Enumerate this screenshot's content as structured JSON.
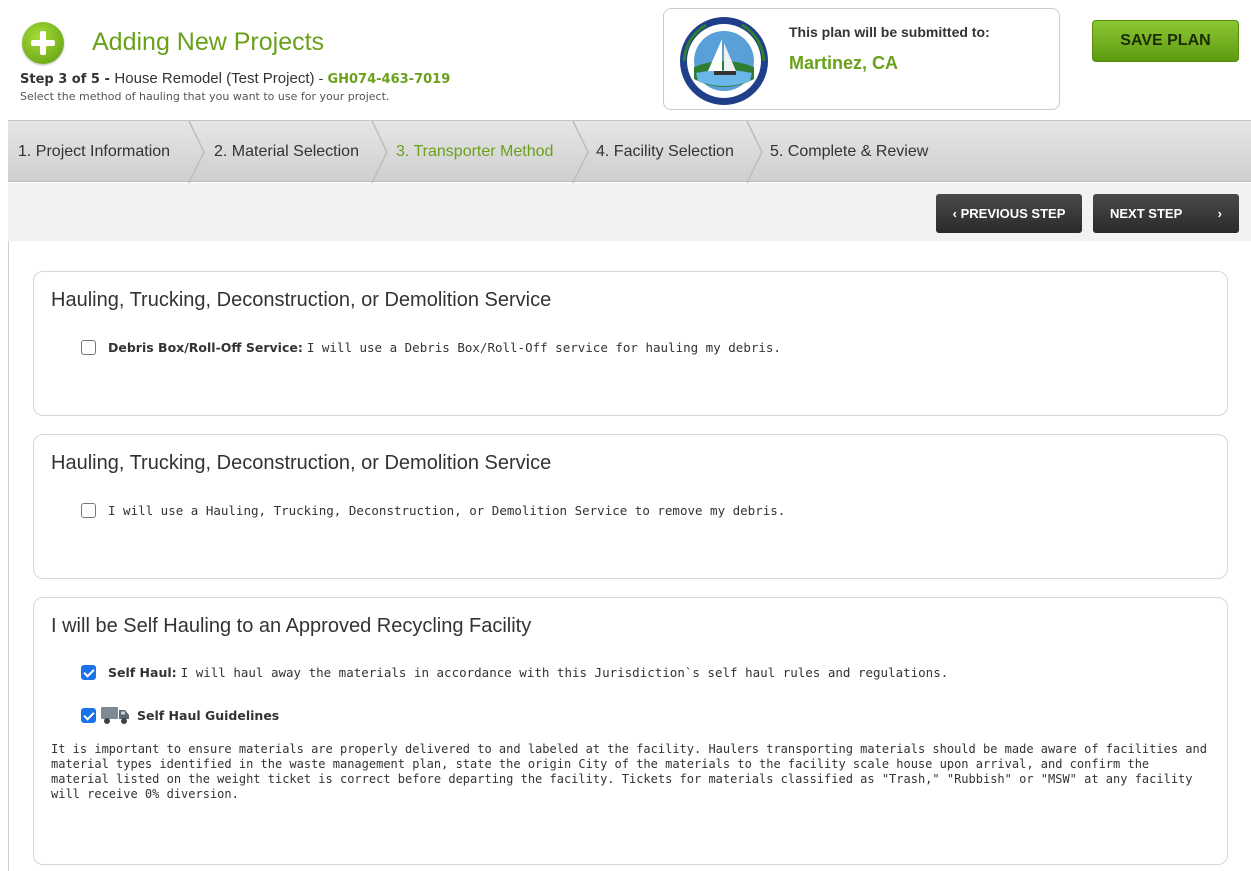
{
  "header": {
    "title": "Adding New Projects",
    "step_prefix": "Step 3 of 5 - ",
    "project_name": "House Remodel (Test Project)",
    "separator": " - ",
    "project_code": "GH074-463-7019",
    "description": "Select the method of hauling that you want to use for your project."
  },
  "submission": {
    "label": "This plan will be submitted to:",
    "city": "Martinez, CA",
    "seal_top_text": "CITY OF MARTINEZ",
    "seal_year": "1876"
  },
  "save_button": {
    "label": "SAVE PLAN"
  },
  "steps": [
    {
      "label": "1. Project Information",
      "active": false
    },
    {
      "label": "2. Material Selection",
      "active": false
    },
    {
      "label": "3. Transporter Method",
      "active": true
    },
    {
      "label": "4. Facility Selection",
      "active": false
    },
    {
      "label": "5. Complete & Review",
      "active": false
    }
  ],
  "nav": {
    "prev_label": "PREVIOUS STEP",
    "prev_icon": "‹",
    "next_label": "NEXT STEP",
    "next_icon": "›"
  },
  "panels": [
    {
      "title": "Hauling, Trucking, Deconstruction, or Demolition Service",
      "option_bold": "Debris Box/Roll-Off Service:",
      "option_text": "I will use a Debris Box/Roll-Off service for hauling my debris.",
      "checked": false
    },
    {
      "title": "Hauling, Trucking, Deconstruction, or Demolition Service",
      "option_text": "I will use a Hauling, Trucking, Deconstruction, or Demolition Service to remove my debris.",
      "checked": false
    },
    {
      "title": "I will be Self Hauling to an Approved Recycling Facility",
      "option_bold": "Self Haul:",
      "option_text": "I will haul away the materials in accordance with this Jurisdiction`s self haul rules and regulations.",
      "checked": true,
      "guidelines_label": "Self Haul Guidelines",
      "guidelines_checked": true,
      "guidelines_icon": "truck-icon",
      "guidelines_text": "It is important to ensure materials are properly delivered to and labeled at the facility. Haulers transporting materials should be made aware of facilities and material types identified in the waste management plan, state the origin City of the materials to the facility scale house upon arrival, and confirm the material listed on the weight ticket is correct before departing the facility. Tickets for materials classified as \"Trash,\" \"Rubbish\" or \"MSW\" at any facility will receive 0% diversion."
    }
  ],
  "colors": {
    "accent_green": "#6aa11a",
    "checkbox_blue": "#1a73e8",
    "nav_button": "#333333"
  }
}
